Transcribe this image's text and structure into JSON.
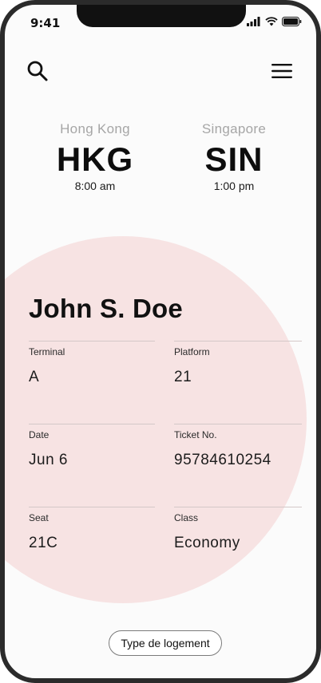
{
  "status": {
    "time": "9:41"
  },
  "header": {
    "search_icon": "search-icon",
    "menu_icon": "hamburger-menu-icon"
  },
  "route": {
    "origin": {
      "city": "Hong Kong",
      "code": "HKG",
      "time": "8:00 am"
    },
    "destination": {
      "city": "Singapore",
      "code": "SIN",
      "time": "1:00 pm"
    }
  },
  "ticket": {
    "passenger": "John S. Doe",
    "fields": {
      "terminal": {
        "label": "Terminal",
        "value": "A"
      },
      "platform": {
        "label": "Platform",
        "value": "21"
      },
      "date": {
        "label": "Date",
        "value": "Jun 6"
      },
      "ticket_no": {
        "label": "Ticket No.",
        "value": "95784610254"
      },
      "seat": {
        "label": "Seat",
        "value": "21C"
      },
      "class": {
        "label": "Class",
        "value": "Economy"
      }
    }
  },
  "footer": {
    "chip_label": "Type de logement"
  },
  "colors": {
    "accent_circle": "#f7e3e3",
    "city_name": "#a6a6a6",
    "frame": "#2b2b2b"
  }
}
